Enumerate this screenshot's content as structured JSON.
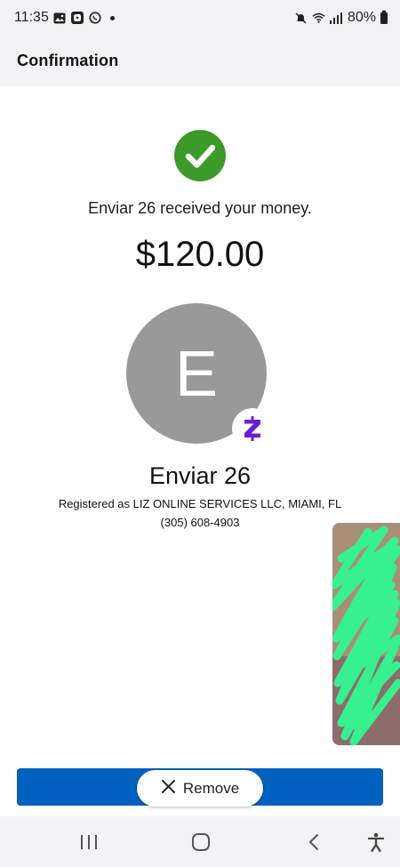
{
  "status_bar": {
    "time": "11:35",
    "battery": "80%",
    "icons_left": [
      "gallery-icon",
      "chase-icon",
      "whatsapp-icon",
      "dot-icon"
    ],
    "icons_right": [
      "mute-icon",
      "wifi-icon",
      "signal-icon",
      "battery-icon"
    ]
  },
  "header": {
    "title": "Confirmation"
  },
  "confirmation": {
    "status_icon": "checkmark-icon",
    "status_color": "#3c9b2a",
    "message": "Enviar 26 received your money.",
    "amount": "$120.00"
  },
  "recipient": {
    "initial": "E",
    "avatar_color": "#999999",
    "badge_icon": "zelle-icon",
    "badge_color": "#6d1ed4",
    "name": "Enviar 26",
    "registered_as": "Registered as LIZ ONLINE SERVICES LLC, MIAMI, FL",
    "phone": "(305) 608-4903"
  },
  "overlay": {
    "remove_label": "Remove",
    "remove_icon": "close-icon",
    "bar_color": "#0061c0"
  },
  "nav": {
    "buttons": [
      "recent-apps-icon",
      "home-icon",
      "back-icon",
      "accessibility-icon"
    ]
  }
}
